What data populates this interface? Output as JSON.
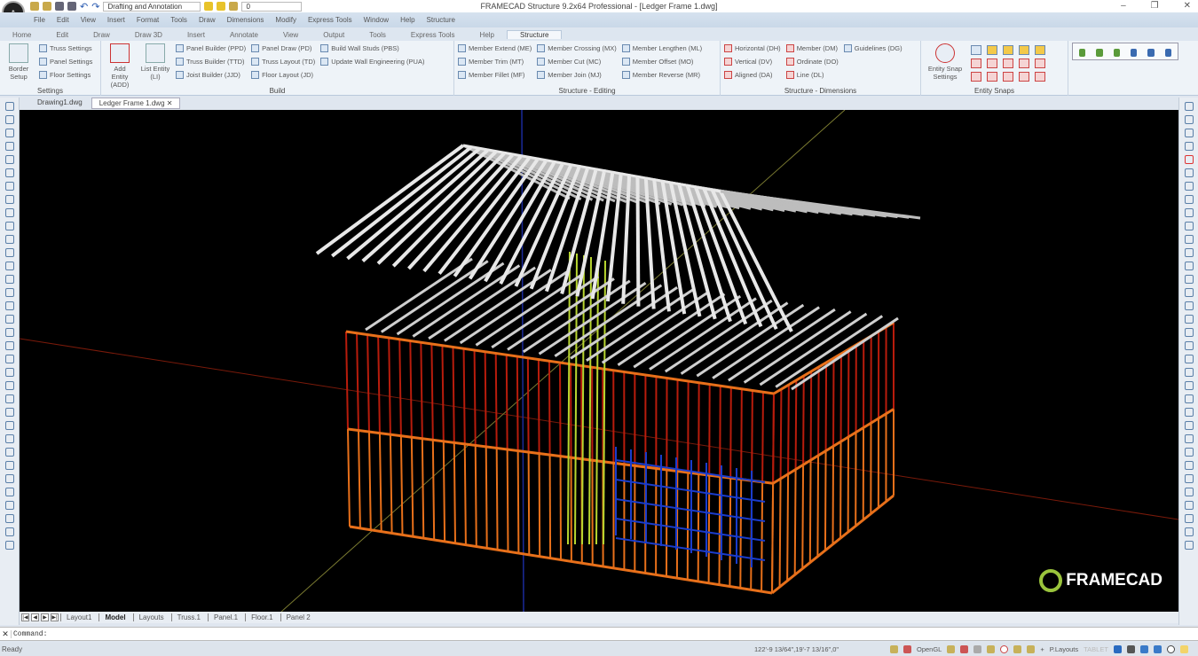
{
  "app": {
    "title": "FRAMECAD Structure 9.2x64 Professional  - [Ledger Frame 1.dwg]",
    "workspace": "Drafting and Annotation",
    "layer": "0"
  },
  "menu": [
    "File",
    "Edit",
    "View",
    "Insert",
    "Format",
    "Tools",
    "Draw",
    "Dimensions",
    "Modify",
    "Express Tools",
    "Window",
    "Help",
    "Structure"
  ],
  "ribbon_tabs": [
    "Home",
    "Edit",
    "Draw",
    "Draw 3D",
    "Insert",
    "Annotate",
    "View",
    "Output",
    "Tools",
    "Express Tools",
    "Help",
    "Structure"
  ],
  "active_ribbon_tab": "Structure",
  "groups": {
    "settings": {
      "label": "Settings",
      "big": "Border Setup",
      "items": [
        "Truss Settings",
        "Panel Settings",
        "Floor Settings"
      ]
    },
    "build": {
      "label": "Build",
      "big": [
        "Add Entity (ADD)",
        "List Entity (LI)"
      ],
      "col1": [
        "Panel Builder (PPD)",
        "Truss Builder (TTD)",
        "Joist Builder (JJD)"
      ],
      "col2": [
        "Panel Draw (PD)",
        "Truss Layout (TD)",
        "Floor Layout (JD)"
      ],
      "col3": [
        "Build Wall Studs (PBS)",
        "Update Wall Engineering (PUA)"
      ]
    },
    "editing": {
      "label": "Structure - Editing",
      "col1": [
        "Member Extend (ME)",
        "Member Trim (MT)",
        "Member Fillet (MF)"
      ],
      "col2": [
        "Member Crossing (MX)",
        "Member Cut (MC)",
        "Member Join (MJ)"
      ],
      "col3": [
        "Member Lengthen (ML)",
        "Member Offset (MO)",
        "Member Reverse (MR)"
      ]
    },
    "dimensions": {
      "label": "Structure - Dimensions",
      "col1": [
        "Horizontal (DH)",
        "Vertical (DV)",
        "Aligned (DA)"
      ],
      "col2": [
        "Member (DM)",
        "Ordinate (DO)",
        "Line (DL)"
      ],
      "col3": [
        "Guidelines (DG)"
      ]
    },
    "snaps": {
      "label": "Entity Snaps",
      "big": "Entity Snap Settings"
    }
  },
  "doc_tabs": [
    "Drawing1.dwg",
    "Ledger Frame 1.dwg"
  ],
  "active_doc": "Ledger Frame 1.dwg",
  "layout_tabs": [
    "Layout1",
    "Model",
    "Layouts",
    "Truss.1",
    "Panel.1",
    "Floor.1",
    "Panel 2"
  ],
  "active_layout": "Model",
  "command": {
    "label": "Command:",
    "value": ""
  },
  "status": {
    "ready": "Ready",
    "coords": "122'-9 13/64\",19'-7 13/16\",0\"",
    "render": "OpenGL",
    "layouts": "P.Layouts",
    "tablet": "TABLET"
  },
  "brand": "FRAMECAD",
  "colors": {
    "viewport": "#000000",
    "lower_walls": "#e8701a",
    "upper_walls": "#b81c0c",
    "roof": "#e8e8e8",
    "inner": "#b8d630",
    "blue_panel": "#1a3ccc",
    "brand_ring": "#9ac43c"
  }
}
